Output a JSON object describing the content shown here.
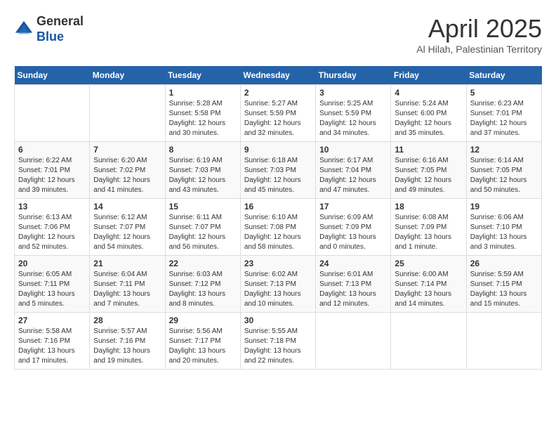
{
  "header": {
    "logo_line1": "General",
    "logo_line2": "Blue",
    "month_title": "April 2025",
    "subtitle": "Al Hilah, Palestinian Territory"
  },
  "weekdays": [
    "Sunday",
    "Monday",
    "Tuesday",
    "Wednesday",
    "Thursday",
    "Friday",
    "Saturday"
  ],
  "weeks": [
    [
      {
        "day": null,
        "info": ""
      },
      {
        "day": null,
        "info": ""
      },
      {
        "day": "1",
        "info": "Sunrise: 5:28 AM\nSunset: 5:58 PM\nDaylight: 12 hours\nand 30 minutes."
      },
      {
        "day": "2",
        "info": "Sunrise: 5:27 AM\nSunset: 5:59 PM\nDaylight: 12 hours\nand 32 minutes."
      },
      {
        "day": "3",
        "info": "Sunrise: 5:25 AM\nSunset: 5:59 PM\nDaylight: 12 hours\nand 34 minutes."
      },
      {
        "day": "4",
        "info": "Sunrise: 5:24 AM\nSunset: 6:00 PM\nDaylight: 12 hours\nand 35 minutes."
      },
      {
        "day": "5",
        "info": "Sunrise: 6:23 AM\nSunset: 7:01 PM\nDaylight: 12 hours\nand 37 minutes."
      }
    ],
    [
      {
        "day": "6",
        "info": "Sunrise: 6:22 AM\nSunset: 7:01 PM\nDaylight: 12 hours\nand 39 minutes."
      },
      {
        "day": "7",
        "info": "Sunrise: 6:20 AM\nSunset: 7:02 PM\nDaylight: 12 hours\nand 41 minutes."
      },
      {
        "day": "8",
        "info": "Sunrise: 6:19 AM\nSunset: 7:03 PM\nDaylight: 12 hours\nand 43 minutes."
      },
      {
        "day": "9",
        "info": "Sunrise: 6:18 AM\nSunset: 7:03 PM\nDaylight: 12 hours\nand 45 minutes."
      },
      {
        "day": "10",
        "info": "Sunrise: 6:17 AM\nSunset: 7:04 PM\nDaylight: 12 hours\nand 47 minutes."
      },
      {
        "day": "11",
        "info": "Sunrise: 6:16 AM\nSunset: 7:05 PM\nDaylight: 12 hours\nand 49 minutes."
      },
      {
        "day": "12",
        "info": "Sunrise: 6:14 AM\nSunset: 7:05 PM\nDaylight: 12 hours\nand 50 minutes."
      }
    ],
    [
      {
        "day": "13",
        "info": "Sunrise: 6:13 AM\nSunset: 7:06 PM\nDaylight: 12 hours\nand 52 minutes."
      },
      {
        "day": "14",
        "info": "Sunrise: 6:12 AM\nSunset: 7:07 PM\nDaylight: 12 hours\nand 54 minutes."
      },
      {
        "day": "15",
        "info": "Sunrise: 6:11 AM\nSunset: 7:07 PM\nDaylight: 12 hours\nand 56 minutes."
      },
      {
        "day": "16",
        "info": "Sunrise: 6:10 AM\nSunset: 7:08 PM\nDaylight: 12 hours\nand 58 minutes."
      },
      {
        "day": "17",
        "info": "Sunrise: 6:09 AM\nSunset: 7:09 PM\nDaylight: 13 hours\nand 0 minutes."
      },
      {
        "day": "18",
        "info": "Sunrise: 6:08 AM\nSunset: 7:09 PM\nDaylight: 13 hours\nand 1 minute."
      },
      {
        "day": "19",
        "info": "Sunrise: 6:06 AM\nSunset: 7:10 PM\nDaylight: 13 hours\nand 3 minutes."
      }
    ],
    [
      {
        "day": "20",
        "info": "Sunrise: 6:05 AM\nSunset: 7:11 PM\nDaylight: 13 hours\nand 5 minutes."
      },
      {
        "day": "21",
        "info": "Sunrise: 6:04 AM\nSunset: 7:11 PM\nDaylight: 13 hours\nand 7 minutes."
      },
      {
        "day": "22",
        "info": "Sunrise: 6:03 AM\nSunset: 7:12 PM\nDaylight: 13 hours\nand 8 minutes."
      },
      {
        "day": "23",
        "info": "Sunrise: 6:02 AM\nSunset: 7:13 PM\nDaylight: 13 hours\nand 10 minutes."
      },
      {
        "day": "24",
        "info": "Sunrise: 6:01 AM\nSunset: 7:13 PM\nDaylight: 13 hours\nand 12 minutes."
      },
      {
        "day": "25",
        "info": "Sunrise: 6:00 AM\nSunset: 7:14 PM\nDaylight: 13 hours\nand 14 minutes."
      },
      {
        "day": "26",
        "info": "Sunrise: 5:59 AM\nSunset: 7:15 PM\nDaylight: 13 hours\nand 15 minutes."
      }
    ],
    [
      {
        "day": "27",
        "info": "Sunrise: 5:58 AM\nSunset: 7:16 PM\nDaylight: 13 hours\nand 17 minutes."
      },
      {
        "day": "28",
        "info": "Sunrise: 5:57 AM\nSunset: 7:16 PM\nDaylight: 13 hours\nand 19 minutes."
      },
      {
        "day": "29",
        "info": "Sunrise: 5:56 AM\nSunset: 7:17 PM\nDaylight: 13 hours\nand 20 minutes."
      },
      {
        "day": "30",
        "info": "Sunrise: 5:55 AM\nSunset: 7:18 PM\nDaylight: 13 hours\nand 22 minutes."
      },
      {
        "day": null,
        "info": ""
      },
      {
        "day": null,
        "info": ""
      },
      {
        "day": null,
        "info": ""
      }
    ]
  ]
}
